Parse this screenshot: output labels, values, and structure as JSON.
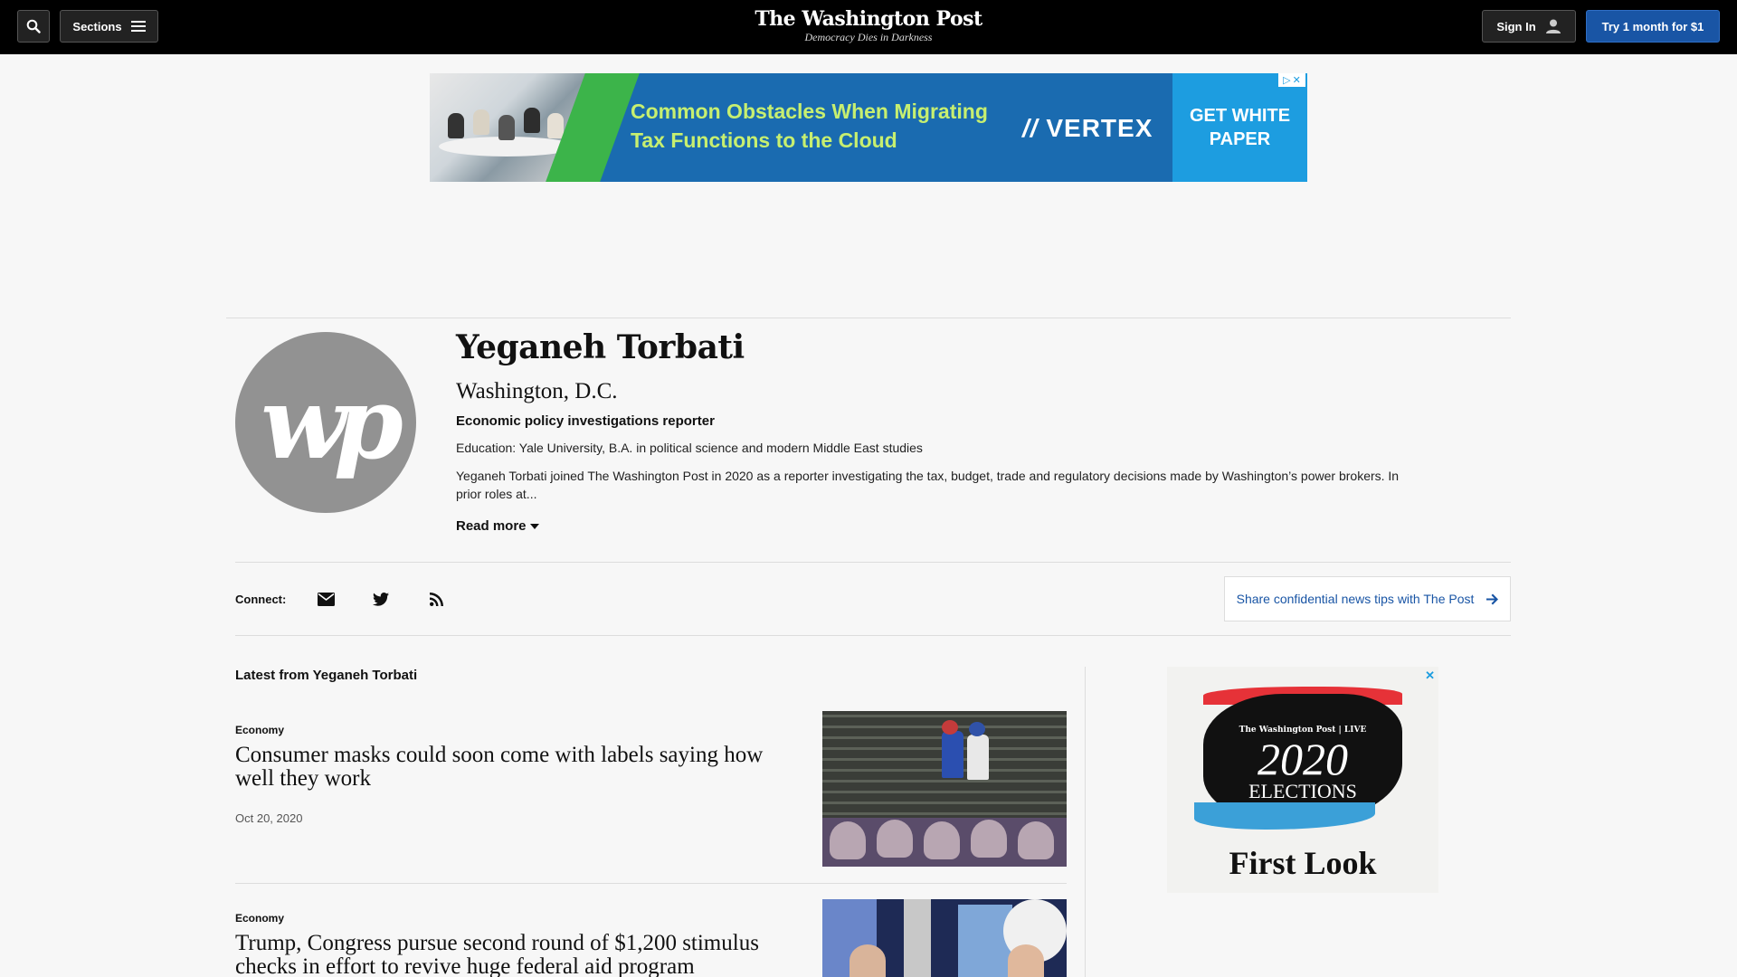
{
  "header": {
    "sections_label": "Sections",
    "logo_title": "The Washington Post",
    "logo_tagline": "Democracy Dies in Darkness",
    "signin_label": "Sign In",
    "try_label": "Try 1 month for $1"
  },
  "top_ad": {
    "headline": "Common Obstacles When Migrating Tax Functions to the Cloud",
    "brand": "VERTEX",
    "cta": "GET WHITE PAPER"
  },
  "profile": {
    "avatar_monogram": "wp",
    "name": "Yeganeh Torbati",
    "location": "Washington, D.C.",
    "role": "Economic policy investigations reporter",
    "education": "Education: Yale University, B.A. in political science and modern Middle East studies",
    "bio": "Yeganeh Torbati joined The Washington Post in 2020 as a reporter investigating the tax, budget, trade and regulatory decisions made by Washington’s power brokers. In prior roles at...",
    "read_more": "Read more"
  },
  "connect": {
    "label": "Connect:",
    "icons": [
      "email-icon",
      "twitter-icon",
      "rss-icon"
    ],
    "tips_label": "Share confidential news tips with The Post"
  },
  "latest": {
    "heading": "Latest from Yeganeh Torbati",
    "articles": [
      {
        "kicker": "Economy",
        "headline": "Consumer masks could soon come with labels saying how well they work",
        "date": "Oct 20, 2020"
      },
      {
        "kicker": "Economy",
        "headline": "Trump, Congress pursue second round of $1,200 stimulus checks in effort to revive huge federal aid program",
        "date": ""
      }
    ]
  },
  "right_ad": {
    "small": "The Washington Post | LIVE",
    "year": "2020",
    "elections": "ELECTIONS",
    "first_look": "First Look"
  },
  "colors": {
    "header_bg": "#000000",
    "accent_blue": "#1955a5",
    "page_bg": "#f7f7f7"
  }
}
